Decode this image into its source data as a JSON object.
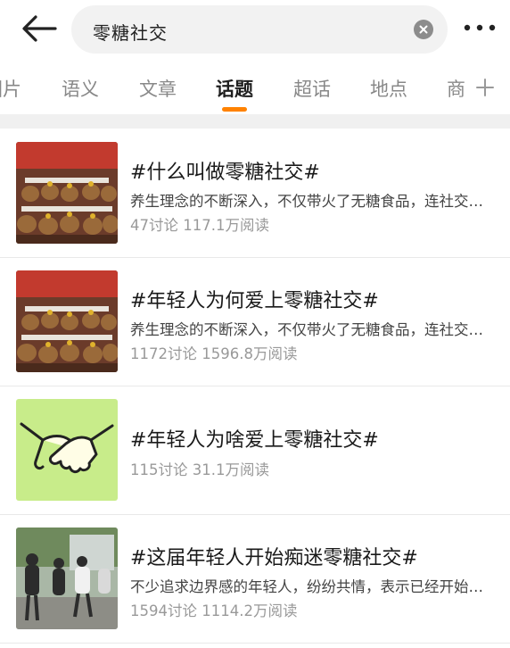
{
  "search": {
    "query": "零糖社交"
  },
  "tabs": [
    {
      "label": "图片"
    },
    {
      "label": "语义"
    },
    {
      "label": "文章"
    },
    {
      "label": "话题"
    },
    {
      "label": "超话"
    },
    {
      "label": "地点"
    },
    {
      "label": "商"
    }
  ],
  "active_tab": "话题",
  "colors": {
    "accent": "#ff8200",
    "search_bg": "#f2f2f2",
    "stats": "#999999"
  },
  "icons": [
    "back-arrow-icon",
    "clear-icon",
    "more-icon",
    "plus-icon"
  ],
  "topics": [
    {
      "title": "#什么叫做零糖社交#",
      "desc": "养生理念的不断深入，不仅带火了无糖食品，连社交也开始追求“零糖”",
      "stats": "47讨论 117.1万阅读",
      "thumb": "capybara-plush-photo"
    },
    {
      "title": "#年轻人为何爱上零糖社交#",
      "desc": "养生理念的不断深入，不仅带火了无糖食品，连社交也开始追求“零糖”",
      "stats": "1172讨论 1596.8万阅读",
      "thumb": "capybara-plush-photo"
    },
    {
      "title": "#年轻人为啥爱上零糖社交#",
      "desc": "",
      "stats": "115讨论 31.1万阅读",
      "thumb": "handshake-illustration"
    },
    {
      "title": "#这届年轻人开始痴迷零糖社交#",
      "desc": "不少追求边界感的年轻人，纷纷共情，表示已经开始零糖社交",
      "stats": "1594讨论 1114.2万阅读",
      "thumb": "people-street-photo"
    }
  ]
}
